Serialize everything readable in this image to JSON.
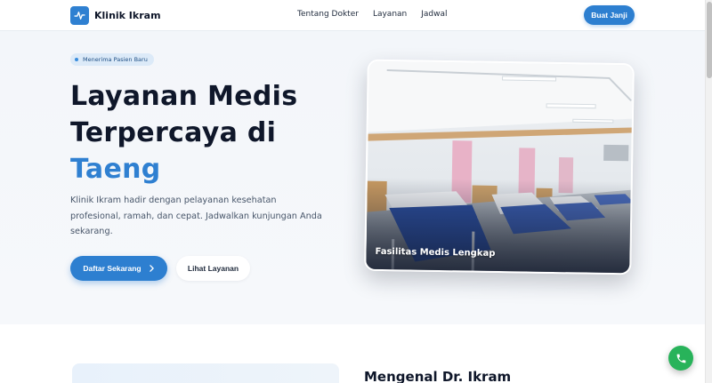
{
  "brand": {
    "name": "Klinik Ikram",
    "icon": "heartbeat-icon",
    "color": "#2f80d1"
  },
  "nav": {
    "links": [
      "Tentang Dokter",
      "Layanan",
      "Jadwal"
    ],
    "cta": "Buat Janji"
  },
  "hero": {
    "badge": "Menerima Pasien Baru",
    "title_line1": "Layanan Medis",
    "title_line2": "Terpercaya di",
    "title_accent": "Taeng",
    "description": "Klinik Ikram hadir dengan pelayanan kesehatan profesional, ramah, dan cepat. Jadwalkan kunjungan Anda sekarang.",
    "primary_button": "Daftar Sekarang",
    "primary_icon": "chevron-right-icon",
    "secondary_button": "Lihat Layanan",
    "photo_caption": "Fasilitas Medis Lengkap"
  },
  "about": {
    "title": "Mengenal Dr. Ikram"
  },
  "floating": {
    "icon": "phone-icon",
    "color": "#28b35a"
  },
  "colors": {
    "accent": "#2f80d1",
    "text": "#0f172a",
    "muted": "#475569"
  }
}
